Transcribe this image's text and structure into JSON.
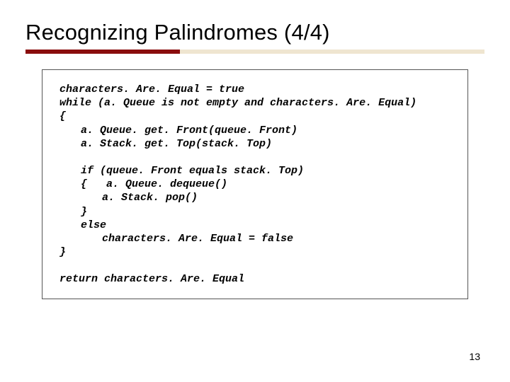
{
  "title": "Recognizing Palindromes (4/4)",
  "code": {
    "l1": "characters. Are. Equal = true",
    "l2": "while (a. Queue is not empty and characters. Are. Equal)",
    "l3": "{",
    "l4": "a. Queue. get. Front(queue. Front)",
    "l5": "a. Stack. get. Top(stack. Top)",
    "l6": "if (queue. Front equals stack. Top)",
    "l7": "{   a. Queue. dequeue()",
    "l8": "a. Stack. pop()",
    "l9": "}",
    "l10": "else",
    "l11": "characters. Are. Equal = false",
    "l12": "}",
    "l13": "return characters. Are. Equal"
  },
  "page_number": "13"
}
